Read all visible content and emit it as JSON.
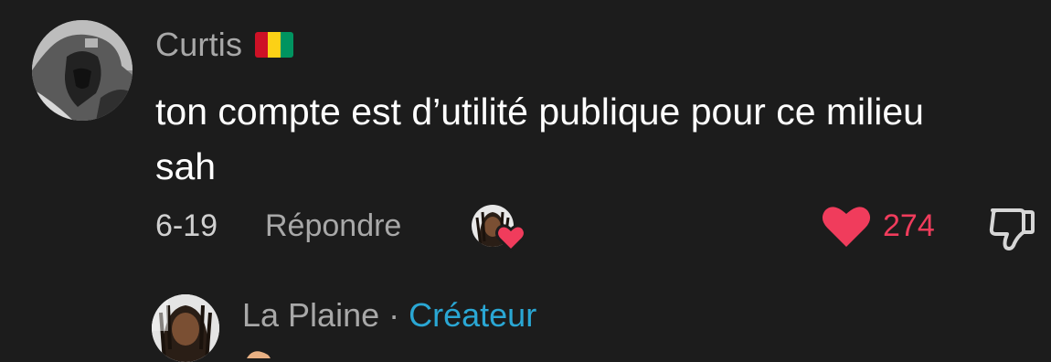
{
  "comment": {
    "author": "Curtis",
    "flag": {
      "name": "guinea-flag",
      "colors": [
        "#ce1126",
        "#fcd116",
        "#009460"
      ]
    },
    "text": "ton compte est d’utilité publique pour ce milieu sah",
    "date": "6-19",
    "reply_label": "Répondre",
    "like_count": "274",
    "like_color": "#f03c5c",
    "liked_by_creator": true
  },
  "reply": {
    "author": "La Plaine",
    "separator": "·",
    "badge": "Créateur",
    "badge_color": "#2aa7d4"
  },
  "icons": {
    "heart": "heart-icon",
    "dislike": "thumbs-down-icon"
  }
}
